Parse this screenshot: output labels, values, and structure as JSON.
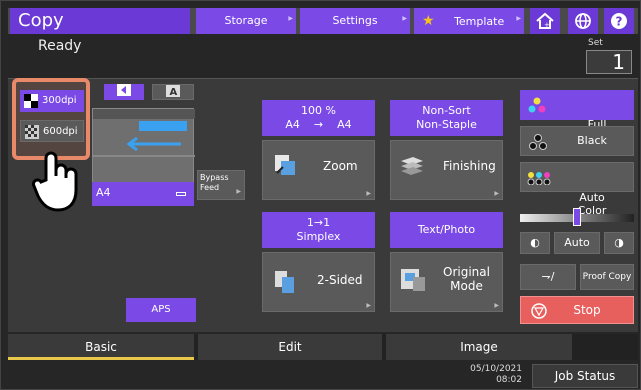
{
  "app": {
    "title": "Copy",
    "status": "Ready"
  },
  "top_nav": [
    {
      "label": "Storage"
    },
    {
      "label": "Settings"
    },
    {
      "label": "Template"
    }
  ],
  "set": {
    "label": "Set",
    "value": "1"
  },
  "resolution": {
    "options": [
      "300dpi",
      "600dpi"
    ],
    "selected": "300dpi"
  },
  "original": {
    "paper": "A4",
    "bypass_label": "Bypass Feed",
    "aps_label": "APS"
  },
  "functions": {
    "zoom": {
      "value": "100 %",
      "detail": "A4    →    A4",
      "label": "Zoom"
    },
    "finishing": {
      "value": "Non-Sort\nNon-Staple",
      "label": "Finishing"
    },
    "two_sided": {
      "value": "1→1\nSimplex",
      "label": "2-Sided"
    },
    "original_mode": {
      "value": "Text/Photo",
      "label": "Original\nMode"
    }
  },
  "color_modes": [
    {
      "label": "Full\nColor",
      "selected": true
    },
    {
      "label": "Black",
      "selected": false
    },
    {
      "label": "Auto\nColor",
      "selected": false
    }
  ],
  "density": {
    "auto_label": "Auto",
    "level": 0.5
  },
  "actions": {
    "proof_copy": "Proof Copy",
    "stop": "Stop"
  },
  "tabs": [
    {
      "label": "Basic",
      "active": true
    },
    {
      "label": "Edit",
      "active": false
    },
    {
      "label": "Image",
      "active": false
    }
  ],
  "footer": {
    "date": "05/10/2021",
    "time": "08:02",
    "job_status": "Job Status"
  },
  "colors": {
    "accent": "#7a49e6",
    "stop": "#e8605e",
    "highlight": "#e8896a",
    "tab_underline": "#e8c84a"
  }
}
